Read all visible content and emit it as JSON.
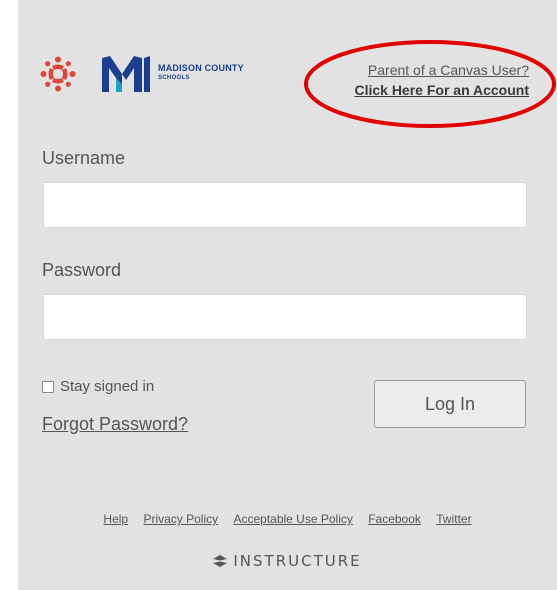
{
  "header": {
    "school_name_line1": "MADISON COUNTY",
    "school_name_line2": "SCHOOLS",
    "parent_question": "Parent of a Canvas User?",
    "parent_link": "Click Here For an Account"
  },
  "form": {
    "username_label": "Username",
    "username_value": "",
    "password_label": "Password",
    "password_value": "",
    "stay_signed_in_label": "Stay signed in",
    "stay_signed_in_checked": false,
    "forgot_password": "Forgot Password?",
    "login_button": "Log In"
  },
  "footer": {
    "links": [
      "Help",
      "Privacy Policy",
      "Acceptable Use Policy",
      "Facebook",
      "Twitter"
    ],
    "brand": "INSTRUCTURE"
  },
  "colors": {
    "panel_bg": "#e2e2e2",
    "canvas_red": "#e0453a",
    "mcs_blue": "#1b3f8f",
    "mcs_teal": "#1da1c7",
    "highlight_ellipse": "#e00000"
  }
}
